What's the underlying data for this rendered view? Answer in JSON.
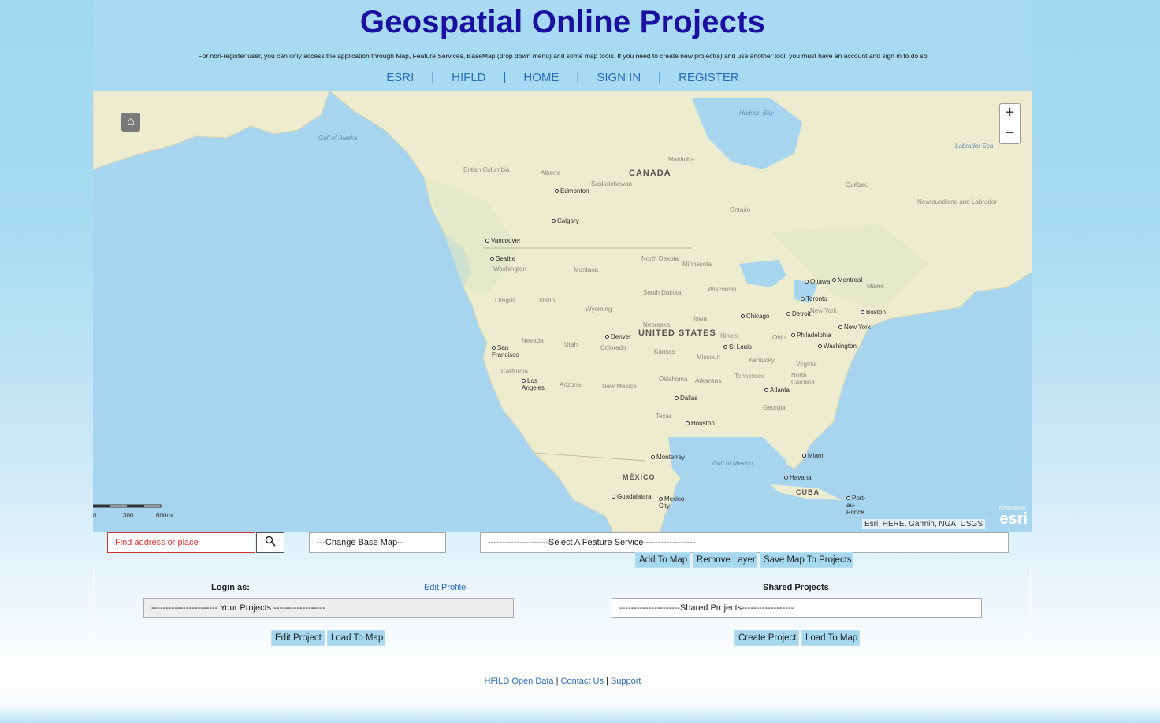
{
  "header": {
    "title": "Geospatial Online Projects",
    "notice": "For non-register user, you can only access the application through Map, Feature Services, BaseMap (drop down menu) and some map tools. If you need to create new project(s) and use another tool, you must have an account and sign in to do so",
    "nav": [
      "ESRI",
      "HIFLD",
      "HOME",
      "SIGN IN",
      "REGISTER"
    ],
    "nav_separator": "|"
  },
  "map": {
    "zoom_in": "+",
    "zoom_out": "−",
    "attribution": "Esri, HERE, Garmin, NGA, USGS",
    "logo": "esri",
    "powered": "POWERED BY",
    "scale": [
      "0",
      "300",
      "600mi"
    ],
    "labels": {
      "countries": [
        "CANADA",
        "UNITED STATES",
        "MÉXICO",
        "CUBA"
      ],
      "water": [
        "Gulf of Alaska",
        "Hudson Bay",
        "Labrador Sea",
        "Gulf of Mexico"
      ],
      "states": [
        "British Columbia",
        "Alberta",
        "Saskatchewan",
        "Manitoba",
        "Ontario",
        "Québec",
        "Newfoundland and Labrador",
        "Washington",
        "Oregon",
        "Idaho",
        "Montana",
        "Wyoming",
        "Nevada",
        "Utah",
        "Colorado",
        "California",
        "Arizona",
        "New Mexico",
        "North Dakota",
        "South Dakota",
        "Nebraska",
        "Kansas",
        "Oklahoma",
        "Texas",
        "Minnesota",
        "Iowa",
        "Missouri",
        "Arkansas",
        "Wisconsin",
        "Illinois",
        "Ohio",
        "Kentucky",
        "Tennessee",
        "Georgia",
        "Virginia",
        "North Carolina",
        "New York",
        "Maine"
      ],
      "cities": [
        "Edmonton",
        "Calgary",
        "Vancouver",
        "Seattle",
        "San Francisco",
        "Los Angeles",
        "Denver",
        "Dallas",
        "Houston",
        "Chicago",
        "St Louis",
        "Detroit",
        "Toronto",
        "Ottawa",
        "Montreal",
        "Boston",
        "New York",
        "Philadelphia",
        "Washington",
        "Atlanta",
        "Miami",
        "Havana",
        "Monterrey",
        "Guadalajara",
        "Mexico City",
        "Port-au-Prince"
      ]
    }
  },
  "controls": {
    "search_placeholder": "Find address or place",
    "basemap_select": "---Change Base Map--",
    "feature_select": "---------------------Select A Feature Service------------------",
    "buttons": {
      "add_to_map": "Add To Map",
      "remove_layer": "Remove Layer",
      "save_map": "Save Map To Projects"
    }
  },
  "left_panel": {
    "login_label": "Login as:",
    "edit_profile": "Edit Profile",
    "projects_select": "----------------------- Your Projects ------------------",
    "edit_project": "Edit Project",
    "load_to_map": "Load To Map"
  },
  "right_panel": {
    "title": "Shared Projects",
    "shared_select": "---------------------Shared Projects------------------",
    "create_project": "Create Project",
    "load_to_map": "Load To Map"
  },
  "footer": {
    "links": [
      "HFILD Open Data",
      "Contact Us",
      "Support"
    ],
    "separator": "|"
  }
}
